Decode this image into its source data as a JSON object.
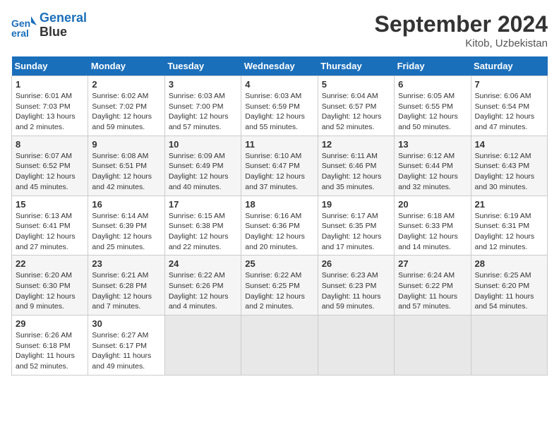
{
  "header": {
    "logo_line1": "General",
    "logo_line2": "Blue",
    "month_title": "September 2024",
    "location": "Kitob, Uzbekistan"
  },
  "weekdays": [
    "Sunday",
    "Monday",
    "Tuesday",
    "Wednesday",
    "Thursday",
    "Friday",
    "Saturday"
  ],
  "weeks": [
    [
      {
        "day": "1",
        "sunrise": "6:01 AM",
        "sunset": "7:03 PM",
        "daylight": "13 hours and 2 minutes."
      },
      {
        "day": "2",
        "sunrise": "6:02 AM",
        "sunset": "7:02 PM",
        "daylight": "12 hours and 59 minutes."
      },
      {
        "day": "3",
        "sunrise": "6:03 AM",
        "sunset": "7:00 PM",
        "daylight": "12 hours and 57 minutes."
      },
      {
        "day": "4",
        "sunrise": "6:03 AM",
        "sunset": "6:59 PM",
        "daylight": "12 hours and 55 minutes."
      },
      {
        "day": "5",
        "sunrise": "6:04 AM",
        "sunset": "6:57 PM",
        "daylight": "12 hours and 52 minutes."
      },
      {
        "day": "6",
        "sunrise": "6:05 AM",
        "sunset": "6:55 PM",
        "daylight": "12 hours and 50 minutes."
      },
      {
        "day": "7",
        "sunrise": "6:06 AM",
        "sunset": "6:54 PM",
        "daylight": "12 hours and 47 minutes."
      }
    ],
    [
      {
        "day": "8",
        "sunrise": "6:07 AM",
        "sunset": "6:52 PM",
        "daylight": "12 hours and 45 minutes."
      },
      {
        "day": "9",
        "sunrise": "6:08 AM",
        "sunset": "6:51 PM",
        "daylight": "12 hours and 42 minutes."
      },
      {
        "day": "10",
        "sunrise": "6:09 AM",
        "sunset": "6:49 PM",
        "daylight": "12 hours and 40 minutes."
      },
      {
        "day": "11",
        "sunrise": "6:10 AM",
        "sunset": "6:47 PM",
        "daylight": "12 hours and 37 minutes."
      },
      {
        "day": "12",
        "sunrise": "6:11 AM",
        "sunset": "6:46 PM",
        "daylight": "12 hours and 35 minutes."
      },
      {
        "day": "13",
        "sunrise": "6:12 AM",
        "sunset": "6:44 PM",
        "daylight": "12 hours and 32 minutes."
      },
      {
        "day": "14",
        "sunrise": "6:12 AM",
        "sunset": "6:43 PM",
        "daylight": "12 hours and 30 minutes."
      }
    ],
    [
      {
        "day": "15",
        "sunrise": "6:13 AM",
        "sunset": "6:41 PM",
        "daylight": "12 hours and 27 minutes."
      },
      {
        "day": "16",
        "sunrise": "6:14 AM",
        "sunset": "6:39 PM",
        "daylight": "12 hours and 25 minutes."
      },
      {
        "day": "17",
        "sunrise": "6:15 AM",
        "sunset": "6:38 PM",
        "daylight": "12 hours and 22 minutes."
      },
      {
        "day": "18",
        "sunrise": "6:16 AM",
        "sunset": "6:36 PM",
        "daylight": "12 hours and 20 minutes."
      },
      {
        "day": "19",
        "sunrise": "6:17 AM",
        "sunset": "6:35 PM",
        "daylight": "12 hours and 17 minutes."
      },
      {
        "day": "20",
        "sunrise": "6:18 AM",
        "sunset": "6:33 PM",
        "daylight": "12 hours and 14 minutes."
      },
      {
        "day": "21",
        "sunrise": "6:19 AM",
        "sunset": "6:31 PM",
        "daylight": "12 hours and 12 minutes."
      }
    ],
    [
      {
        "day": "22",
        "sunrise": "6:20 AM",
        "sunset": "6:30 PM",
        "daylight": "12 hours and 9 minutes."
      },
      {
        "day": "23",
        "sunrise": "6:21 AM",
        "sunset": "6:28 PM",
        "daylight": "12 hours and 7 minutes."
      },
      {
        "day": "24",
        "sunrise": "6:22 AM",
        "sunset": "6:26 PM",
        "daylight": "12 hours and 4 minutes."
      },
      {
        "day": "25",
        "sunrise": "6:22 AM",
        "sunset": "6:25 PM",
        "daylight": "12 hours and 2 minutes."
      },
      {
        "day": "26",
        "sunrise": "6:23 AM",
        "sunset": "6:23 PM",
        "daylight": "11 hours and 59 minutes."
      },
      {
        "day": "27",
        "sunrise": "6:24 AM",
        "sunset": "6:22 PM",
        "daylight": "11 hours and 57 minutes."
      },
      {
        "day": "28",
        "sunrise": "6:25 AM",
        "sunset": "6:20 PM",
        "daylight": "11 hours and 54 minutes."
      }
    ],
    [
      {
        "day": "29",
        "sunrise": "6:26 AM",
        "sunset": "6:18 PM",
        "daylight": "11 hours and 52 minutes."
      },
      {
        "day": "30",
        "sunrise": "6:27 AM",
        "sunset": "6:17 PM",
        "daylight": "11 hours and 49 minutes."
      },
      null,
      null,
      null,
      null,
      null
    ]
  ]
}
